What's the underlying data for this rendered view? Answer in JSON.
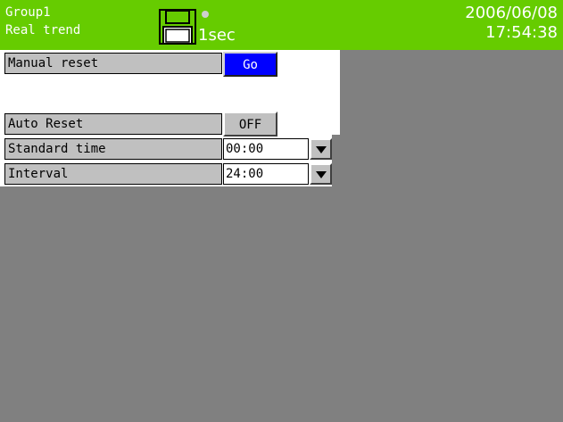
{
  "header": {
    "group": "Group1",
    "mode": "Real trend",
    "sampling": "1sec",
    "date": "2006/06/08",
    "time": "17:54:38",
    "icons": [
      "floppy-disk-icon",
      "status-dot-icon"
    ],
    "bg_color": "#66cc00"
  },
  "manual_reset": {
    "label": "Manual reset",
    "button": "Go",
    "button_color": "#0000ff"
  },
  "auto_reset": {
    "label": "Auto Reset",
    "button": "OFF"
  },
  "standard_time": {
    "label": "Standard time",
    "value": "00:00"
  },
  "interval": {
    "label": "Interval",
    "value": "24:00"
  },
  "colors": {
    "background": "#808080",
    "label_bg": "#c0c0c0"
  }
}
